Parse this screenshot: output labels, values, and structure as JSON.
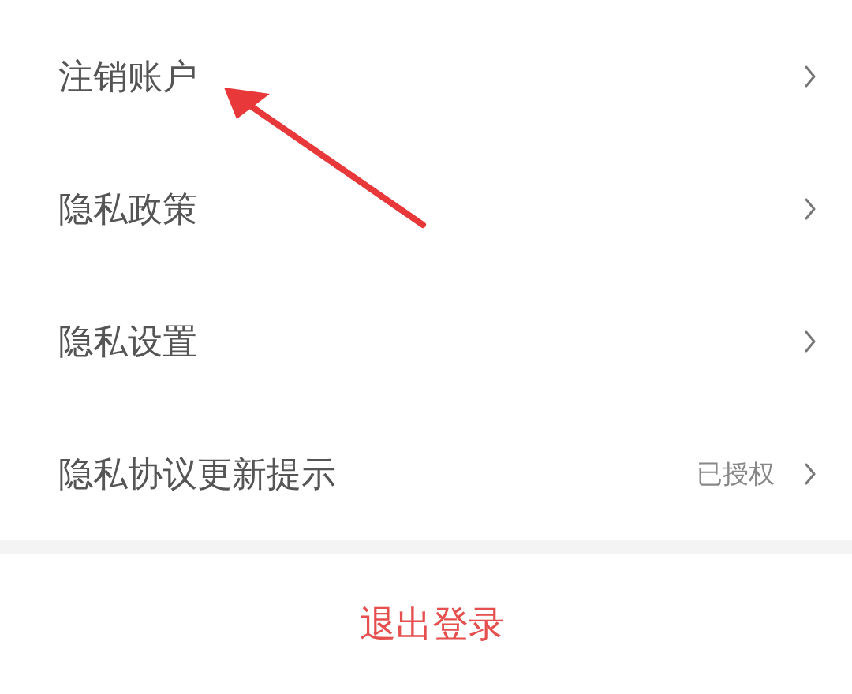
{
  "menu_items": [
    {
      "label": "注销账户"
    },
    {
      "label": "隐私政策"
    },
    {
      "label": "隐私设置"
    },
    {
      "label": "隐私协议更新提示",
      "value": "已授权"
    }
  ],
  "logout_button": "退出登录"
}
